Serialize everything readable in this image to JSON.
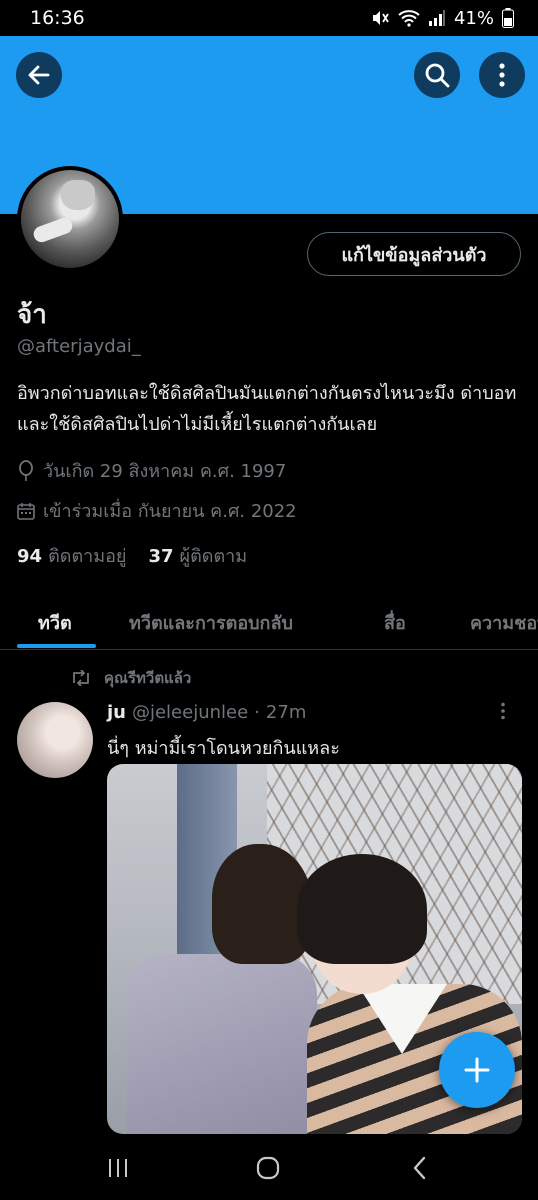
{
  "status": {
    "time": "16:36",
    "battery": "41%",
    "icons": [
      "mute-icon",
      "wifi-icon",
      "signal-icon",
      "battery-icon"
    ]
  },
  "header": {
    "banner_color": "#1d9bf0",
    "back_icon": "arrow-left-icon",
    "search_icon": "search-icon",
    "more_icon": "more-vertical-icon"
  },
  "profile": {
    "edit_button_label": "แก้ไขข้อมูลส่วนตัว",
    "display_name": "จ้า",
    "handle": "@afterjaydai_",
    "bio": "อิพวกด่าบอทและใช้ดิสศิลปินมันแตกต่างกันตรงไหนวะมึง ด่าบอทและใช้ดิสศิลปินไปด่าไม่มีเหี้ยไรแตกต่างกันเลย",
    "birthdate": "วันเกิด 29 สิงหาคม ค.ศ. 1997",
    "joined": "เข้าร่วมเมื่อ กันยายน ค.ศ. 2022",
    "following_count": "94",
    "following_label": "ติดตามอยู่",
    "followers_count": "37",
    "followers_label": "ผู้ติดตาม"
  },
  "tabs": [
    {
      "label": "ทวีต",
      "active": true
    },
    {
      "label": "ทวีตและการตอบกลับ",
      "active": false
    },
    {
      "label": "สื่อ",
      "active": false
    },
    {
      "label": "ความชอบ",
      "active": false
    }
  ],
  "tweet": {
    "retweet_label": "คุณรีทวีตแล้ว",
    "author_name": "ju",
    "author_handle": "@jeleejunlee",
    "separator": "·",
    "time": "27m",
    "text": "นี่ๆ หม่ามี้เราโดนหวยกินแหละ"
  },
  "fab": {
    "icon": "plus-icon",
    "color": "#1d9bf0"
  },
  "navbar": {
    "icons": [
      "recent-apps-icon",
      "home-icon",
      "back-icon"
    ]
  }
}
